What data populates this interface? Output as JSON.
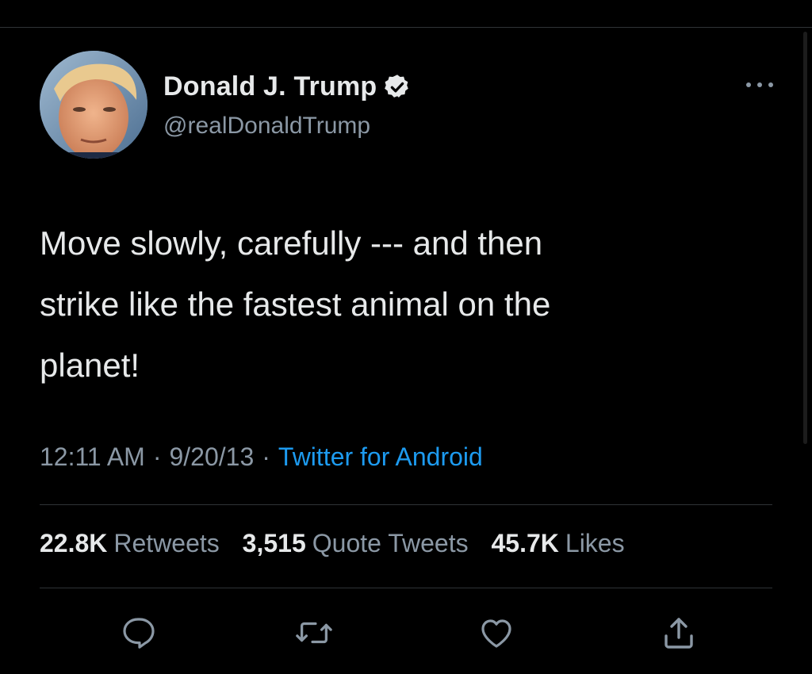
{
  "author": {
    "display_name": "Donald J. Trump",
    "handle": "@realDonaldTrump",
    "verified": true
  },
  "tweet": {
    "text": "Move slowly, carefully --- and then\nstrike like the fastest animal on the\nplanet!",
    "time": "12:11 AM",
    "date": "9/20/13",
    "separator": "·",
    "source": "Twitter for Android"
  },
  "stats": {
    "retweets_count": "22.8K",
    "retweets_label": "Retweets",
    "quotes_count": "3,515",
    "quotes_label": "Quote Tweets",
    "likes_count": "45.7K",
    "likes_label": "Likes"
  },
  "icons": {
    "more": "more-dots-icon",
    "verified": "verified-badge-icon",
    "reply": "reply-icon",
    "retweet": "retweet-icon",
    "like": "heart-icon",
    "share": "share-icon"
  },
  "colors": {
    "background": "#000000",
    "text": "#e7e9ea",
    "secondary": "#8b98a5",
    "accent": "#1d9bf0",
    "divider": "#2f3336"
  }
}
